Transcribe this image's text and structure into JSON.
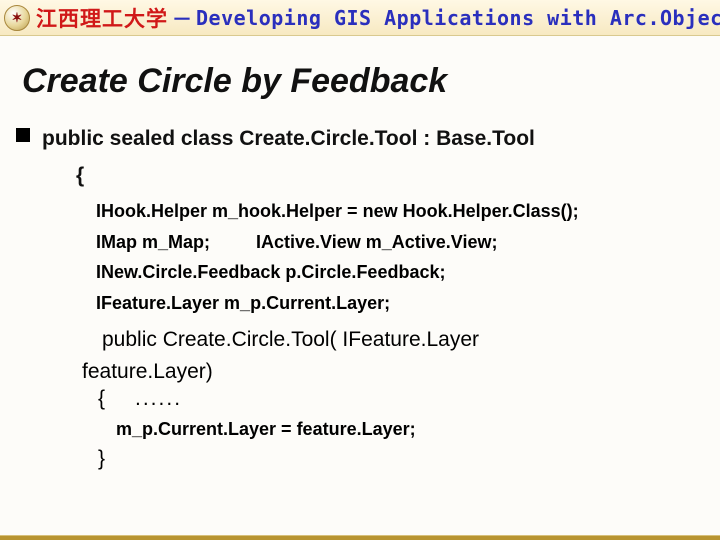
{
  "header": {
    "cn": "江西理工大学",
    "dash": "－",
    "en": "Developing GIS Applications with Arc.Objects using C#. NE",
    "logo_glyph": "✶"
  },
  "title": "Create Circle by Feedback",
  "code": {
    "class_decl": "public sealed class Create.Circle.Tool : Base.Tool",
    "open_brace": "{",
    "line1": "IHook.Helper m_hook.Helper = new Hook.Helper.Class();",
    "line2a": "IMap m_Map;",
    "line2b": "IActive.View m_Active.View;",
    "line3": "INew.Circle.Feedback p.Circle.Feedback;",
    "line4": "IFeature.Layer m_p.Current.Layer;",
    "ctor_sig1": "public Create.Circle.Tool( IFeature.Layer",
    "ctor_sig2": "feature.Layer)",
    "ctor_open": "{",
    "ctor_dots": "......",
    "ctor_body": "m_p.Current.Layer = feature.Layer;",
    "ctor_close": "}"
  }
}
